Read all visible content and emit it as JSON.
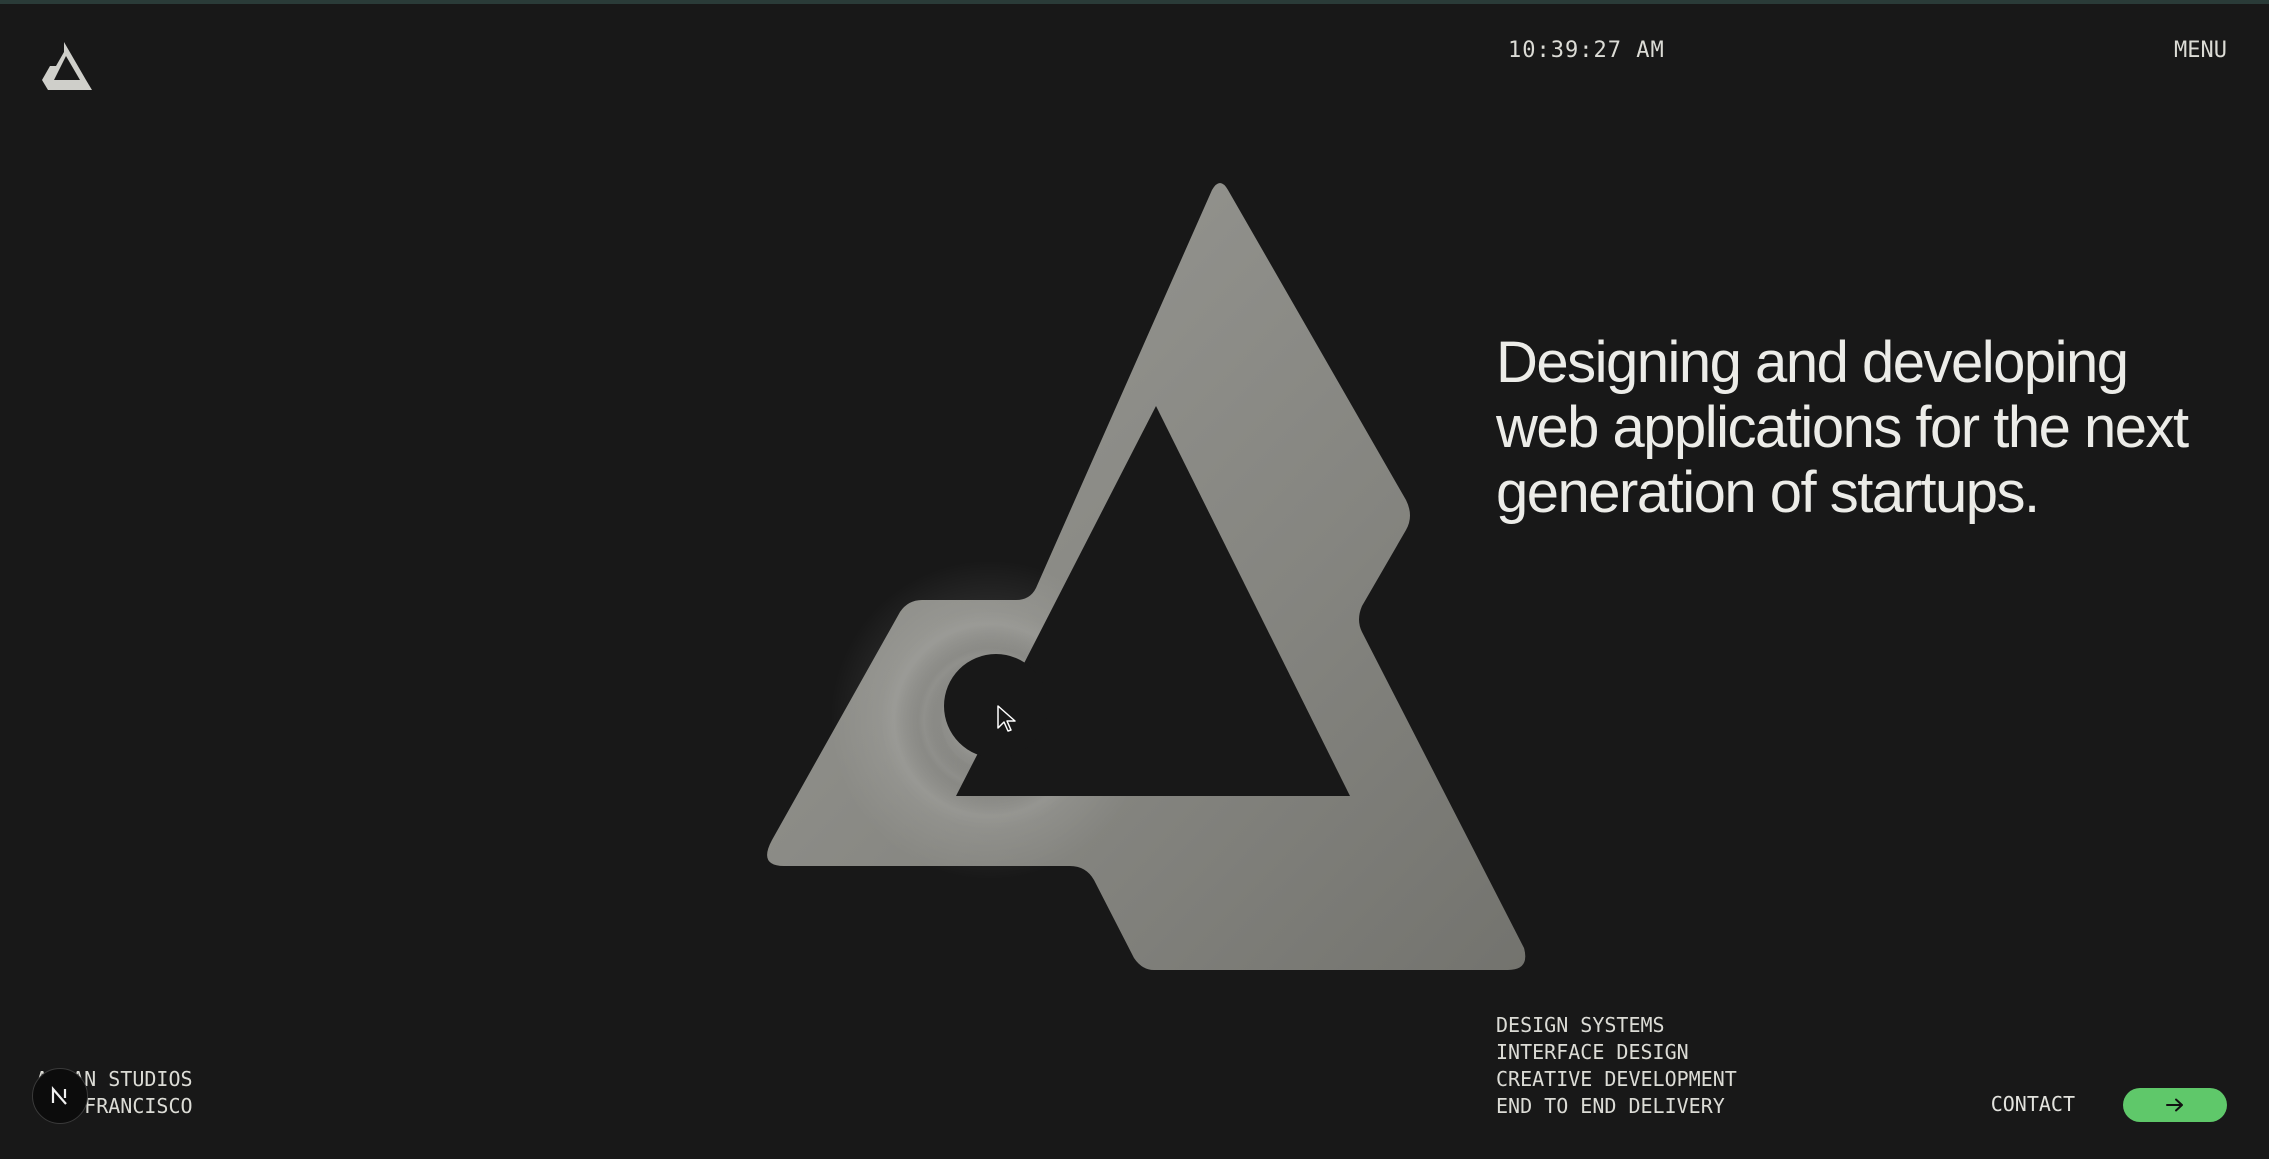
{
  "header": {
    "clock": "10:39:27 AM",
    "menu_label": "MENU",
    "logo_icon": "triangle-logo-icon"
  },
  "hero": {
    "headline": "Designing and developing web applications for the next generation of startups.",
    "mark_icon": "triangle-logo-3d-icon"
  },
  "services": [
    "DESIGN SYSTEMS",
    "INTERFACE DESIGN",
    "CREATIVE DEVELOPMENT",
    "END TO END DELIVERY"
  ],
  "studio": {
    "line1": "ALHAN STUDIOS",
    "line2": "SAN FRANCISCO"
  },
  "contact": {
    "label": "CONTACT",
    "button_icon": "arrow-right-icon"
  },
  "colors": {
    "background": "#181818",
    "accent": "#5fc86a",
    "text": "#e6e6e1",
    "mark": "#8c8c86"
  }
}
